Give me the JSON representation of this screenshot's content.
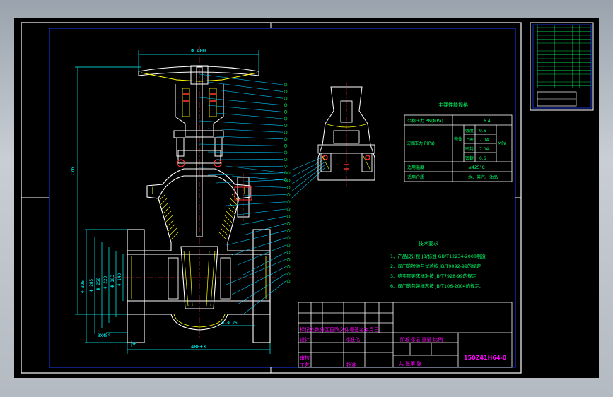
{
  "colors": {
    "background": "#000000",
    "frame": "#ffffff",
    "border": "#1a3cff",
    "geometry": "#ffffff",
    "hatch": "#ffff00",
    "dimension": "#00ffff",
    "leader": "#00c8ff",
    "label": "#00ff66",
    "title_text": "#ff00ff",
    "center": "#ff3030"
  },
  "dimensions": {
    "width_top": "Φ 400",
    "height_left": "776",
    "d140": "Φ 140",
    "d183": "Φ 183",
    "d220": "Φ 220",
    "d250": "Φ 250",
    "d285": "Φ 285",
    "d395": "Φ 395",
    "chamfer": "3X45°",
    "flange_thk": "36",
    "bolt": "8-Φ 26",
    "len_bottom": "480±3"
  },
  "params_table": {
    "title": "主要性能规格",
    "row1_label": "公称压力 PN(MPa)",
    "row1_value": "6.4",
    "test_label": "试验压力 P(Ps)",
    "test_sub": "壳体",
    "unit": "MPa",
    "test_rows": [
      {
        "label": "强度",
        "value": "9.6"
      },
      {
        "label": "上密",
        "value": "7.04"
      },
      {
        "label": "密封",
        "value": "7.04"
      },
      {
        "label": "密封",
        "value": "0.6"
      }
    ],
    "temp_label": "适用温度",
    "temp_value": "≤425°C",
    "medium_label": "适用介质",
    "medium_value": "水、蒸汽、油品"
  },
  "tech_req": {
    "title": "技术要求",
    "items": [
      "1、产品设计按 JB/标准 GB/T12234-2008制造",
      "2、阀门的检验与试验按 JB/T9092-99的规定",
      "3、结实度要求标准按 JB/T7928-99的规定",
      "6、阀门的包装标志按 JB/T106-2004的规定、"
    ]
  },
  "title_block": {
    "header_row": "标记处数分区更改文件号签名年月日",
    "designer": "设计",
    "std": "标准化",
    "check": "审核",
    "process": "工艺",
    "approve": "批准",
    "stage": "阶段标记 重量 比例",
    "sheets": "共 张第 张",
    "drawing_no": "150Z41H64-0"
  },
  "balloons": {
    "upper_count": 15,
    "right_count": 16
  }
}
